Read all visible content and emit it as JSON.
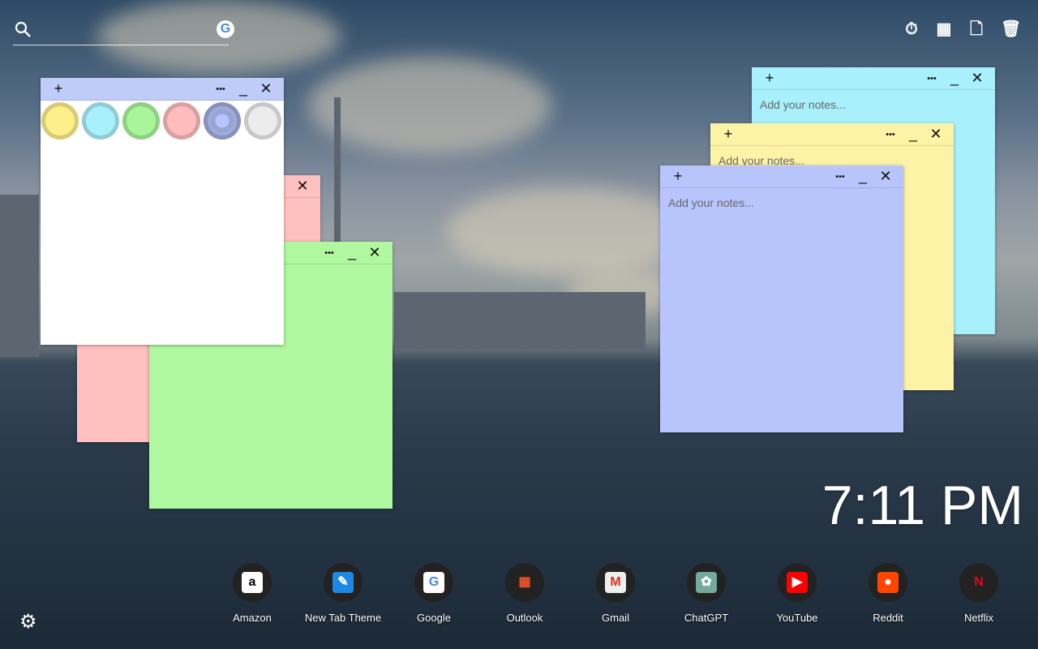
{
  "search": {
    "icon": "search-icon",
    "engine_icon": "google-icon",
    "engine_letter": "G"
  },
  "toolbar": [
    {
      "icon": "stopwatch-icon",
      "glyph": "⏱"
    },
    {
      "icon": "calculator-icon",
      "glyph": "▦"
    },
    {
      "icon": "add-note-icon",
      "glyph": "🗋"
    },
    {
      "icon": "trash-icon",
      "glyph": "🗑"
    }
  ],
  "note_controls": {
    "add": "+",
    "more": "•••",
    "minimize": "_",
    "close": "✕"
  },
  "notes": [
    {
      "color": "#a8f0fc",
      "placeholder": "Add your notes..."
    },
    {
      "color": "#fdf3a6",
      "placeholder": "Add your notes..."
    },
    {
      "color": "#b8c4fc",
      "placeholder": "Add your notes..."
    },
    {
      "color": "#ffc0c0",
      "placeholder": ""
    },
    {
      "color": "#b0f8a0",
      "placeholder": ""
    }
  ],
  "color_picker": {
    "header_color": "#c0ccf8",
    "swatches": [
      "#fdf08a",
      "#a8f0fc",
      "#a8f59a",
      "#ffbcbc",
      "#a0acdc",
      "#ececec"
    ],
    "selected": 4
  },
  "clock": "7:11 PM",
  "shortcuts": [
    {
      "label": "Amazon",
      "icon": "amazon-icon",
      "glyph": "a",
      "bg": "#fff",
      "fg": "#000"
    },
    {
      "label": "New Tab Theme",
      "icon": "new-tab-theme-icon",
      "glyph": "✎",
      "bg": "#1e88e5",
      "fg": "#fff"
    },
    {
      "label": "Google",
      "icon": "google-icon",
      "glyph": "G",
      "bg": "#fff",
      "fg": "#4285f4"
    },
    {
      "label": "Outlook",
      "icon": "microsoft-icon",
      "glyph": "▦",
      "bg": "#222",
      "fg": "#f35325"
    },
    {
      "label": "Gmail",
      "icon": "gmail-icon",
      "glyph": "M",
      "bg": "#eee",
      "fg": "#d93025"
    },
    {
      "label": "ChatGPT",
      "icon": "chatgpt-icon",
      "glyph": "✿",
      "bg": "#74aa9c",
      "fg": "#fff"
    },
    {
      "label": "YouTube",
      "icon": "youtube-icon",
      "glyph": "▶",
      "bg": "#f00",
      "fg": "#fff"
    },
    {
      "label": "Reddit",
      "icon": "reddit-icon",
      "glyph": "●",
      "bg": "#ff4500",
      "fg": "#fff"
    },
    {
      "label": "Netflix",
      "icon": "netflix-icon",
      "glyph": "N",
      "bg": "#222",
      "fg": "#e50914"
    }
  ],
  "settings": {
    "icon": "settings-icon",
    "glyph": "⚙"
  }
}
